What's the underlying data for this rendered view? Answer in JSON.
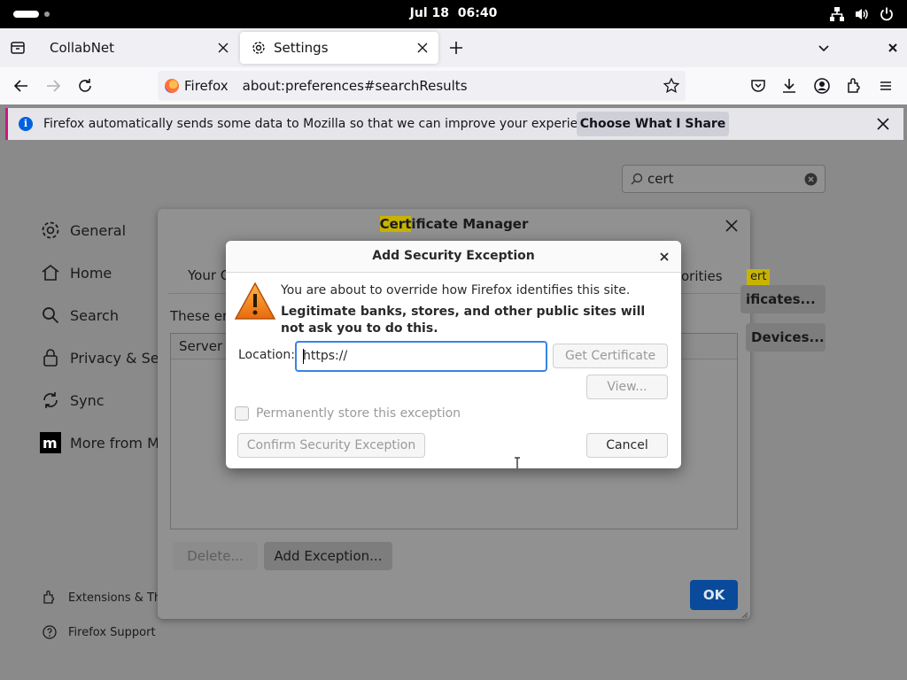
{
  "topbar": {
    "date": "Jul 18",
    "time": "06:40"
  },
  "tabs": [
    {
      "label": "CollabNet"
    },
    {
      "label": "Settings"
    }
  ],
  "navbar": {
    "identity_label": "Firefox",
    "url": "about:preferences#searchResults"
  },
  "infobar": {
    "message": "Firefox automatically sends some data to Mozilla so that we can improve your experience.",
    "button_label": "Choose What I Share"
  },
  "settings_page": {
    "search_value": "cert",
    "categories": [
      {
        "label": "General",
        "icon": "gear-icon"
      },
      {
        "label": "Home",
        "icon": "home-icon"
      },
      {
        "label": "Search",
        "icon": "search-icon"
      },
      {
        "label": "Privacy & Secu",
        "icon": "lock-icon"
      },
      {
        "label": "Sync",
        "icon": "sync-icon"
      },
      {
        "label": "More from Mo",
        "icon": "mozilla-icon"
      }
    ],
    "footer_links": [
      {
        "label": "Extensions & The",
        "icon": "extension-icon"
      },
      {
        "label": "Firefox Support",
        "icon": "help-icon"
      }
    ],
    "peek": {
      "authorities": "orities",
      "cert_hl": "ert",
      "certificates_btn": "ificates...",
      "devices_btn": "Devices..."
    }
  },
  "cert_manager": {
    "title_highlight": "Cert",
    "title_rest": "ificate Manager",
    "tab_left": "Your C",
    "entries_text": "These ent",
    "column_server": "Server",
    "delete_label": "Delete...",
    "add_exception_label": "Add Exception...",
    "ok_label": "OK"
  },
  "add_exception": {
    "title": "Add Security Exception",
    "message_line": "You are about to override how Firefox identifies this site.",
    "message_bold": "Legitimate banks, stores, and other public sites will not ask you to do this.",
    "location_label": "Location:",
    "location_value": "https://",
    "get_certificate_label": "Get Certificate",
    "view_label": "View...",
    "permanent_label": "Permanently store this exception",
    "confirm_label": "Confirm Security Exception",
    "cancel_label": "Cancel"
  },
  "colors": {
    "accent_blue": "#0061e0",
    "focus_blue": "#3584e4",
    "highlight_yellow": "#c8b400",
    "ok_button": "#0a4a9b"
  }
}
